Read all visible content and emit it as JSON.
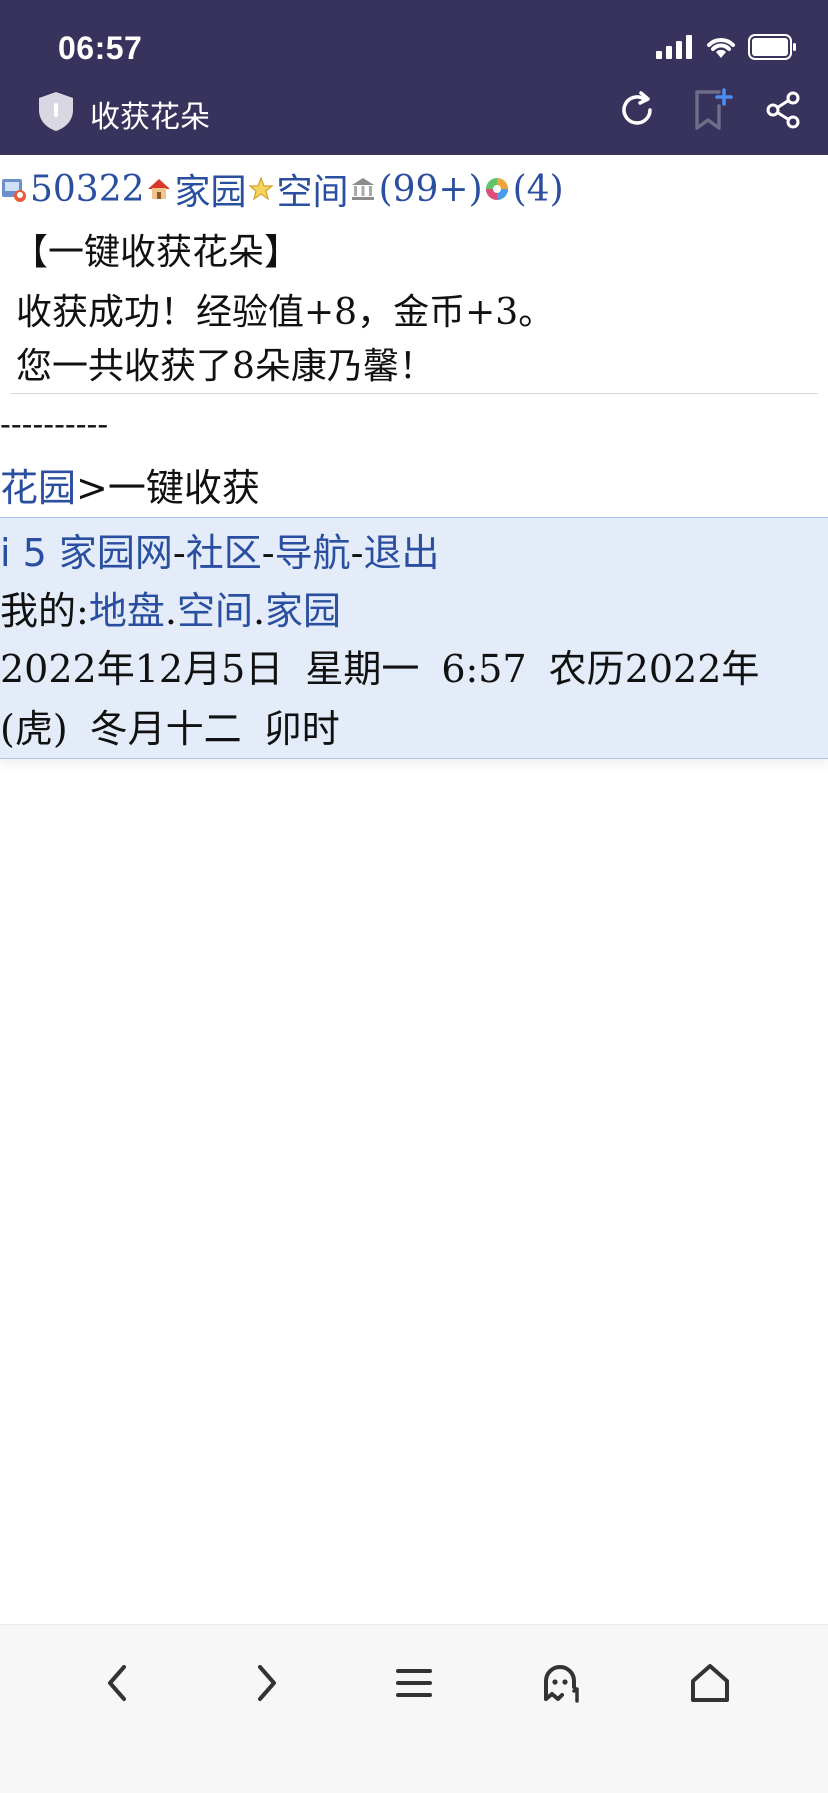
{
  "status": {
    "time": "06:57"
  },
  "header": {
    "title": "收获花朵"
  },
  "topbar": {
    "user_id": "50322",
    "home": "家园",
    "space": "空间",
    "count1": "(99+)",
    "count2": "(4)"
  },
  "content": {
    "heading": "【一键收获花朵】",
    "msg1_a": "收获成功！经验值",
    "msg1_b": "+8",
    "msg1_c": "，金币",
    "msg1_d": "+3",
    "msg1_e": "。",
    "msg2_a": "您一共收获了",
    "msg2_b": "8",
    "msg2_c": "朵康乃馨！",
    "dashes": "----------",
    "crumb_link": "花园",
    "crumb_sep": ">",
    "crumb_current": "一键收获"
  },
  "footer": {
    "site": "i 5 家园网",
    "sep": "-",
    "community": "社区",
    "nav": "导航",
    "logout": "退出",
    "mine_label": "我的",
    "colon": ":",
    "land": "地盘",
    "dot": ".",
    "space": "空间",
    "home": "家园",
    "date_y": "2022",
    "date_y_u": "年",
    "date_m": "12",
    "date_m_u": "月",
    "date_d": "5",
    "date_d_u": "日",
    "weekday": "星期一",
    "clock": "6:57",
    "lunar_label": "农历",
    "lunar_year": "2022",
    "lunar_year_u": "年",
    "zodiac_open": "(",
    "zodiac": "虎",
    "zodiac_close": ")",
    "lunar_day": "冬月十二",
    "shichen": "卯时"
  },
  "colors": {
    "header_bg": "#37335c",
    "link": "#2a4ea0",
    "footer_bg": "#e3ecf8",
    "bookmark_accent": "#4d8df0"
  },
  "toolbar": {
    "icons": [
      "back-icon",
      "forward-icon",
      "menu-icon",
      "ghost-icon",
      "home-icon"
    ]
  }
}
